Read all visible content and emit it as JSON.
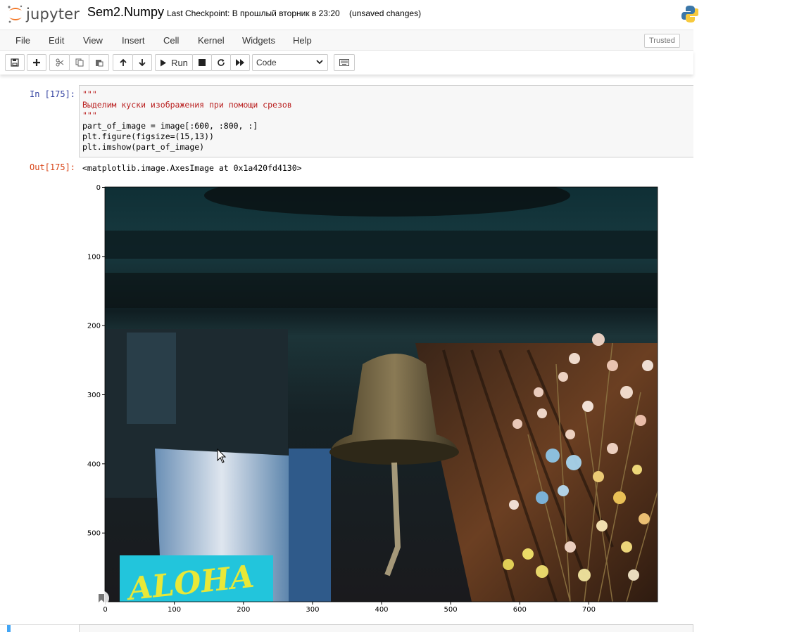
{
  "header": {
    "logo_text": "jupyter",
    "notebook_title": "Sem2.Numpy",
    "checkpoint": "Last Checkpoint: В прошлый вторник в 23:20",
    "save_status": "(unsaved changes)"
  },
  "menubar": {
    "items": [
      {
        "label": "File"
      },
      {
        "label": "Edit"
      },
      {
        "label": "View"
      },
      {
        "label": "Insert"
      },
      {
        "label": "Cell"
      },
      {
        "label": "Kernel"
      },
      {
        "label": "Widgets"
      },
      {
        "label": "Help"
      }
    ],
    "trusted": "Trusted"
  },
  "toolbar": {
    "run_label": "Run",
    "cell_type": "Code"
  },
  "cell": {
    "in_prompt": "In [175]:",
    "out_prompt": "Out[175]:",
    "code_lines": [
      "\"\"\"",
      "Выделим куски изображения при помощи срезов",
      "\"\"\"",
      "part_of_image = image[:600, :800, :]",
      "plt.figure(figsize=(15,13))",
      "plt.imshow(part_of_image)"
    ],
    "output_text": "<matplotlib.image.AxesImage at 0x1a420fd4130>"
  },
  "plot": {
    "x_ticks": [
      "0",
      "100",
      "200",
      "300",
      "400",
      "500",
      "600",
      "700"
    ],
    "y_ticks": [
      "0",
      "100",
      "200",
      "300",
      "400",
      "500"
    ],
    "image_overlay_text": "ALOHA",
    "image_width": 800,
    "image_height": 600
  },
  "colors": {
    "in_prompt": "#303f9f",
    "out_prompt": "#d84315",
    "string": "#ba2121",
    "number": "#008000"
  }
}
